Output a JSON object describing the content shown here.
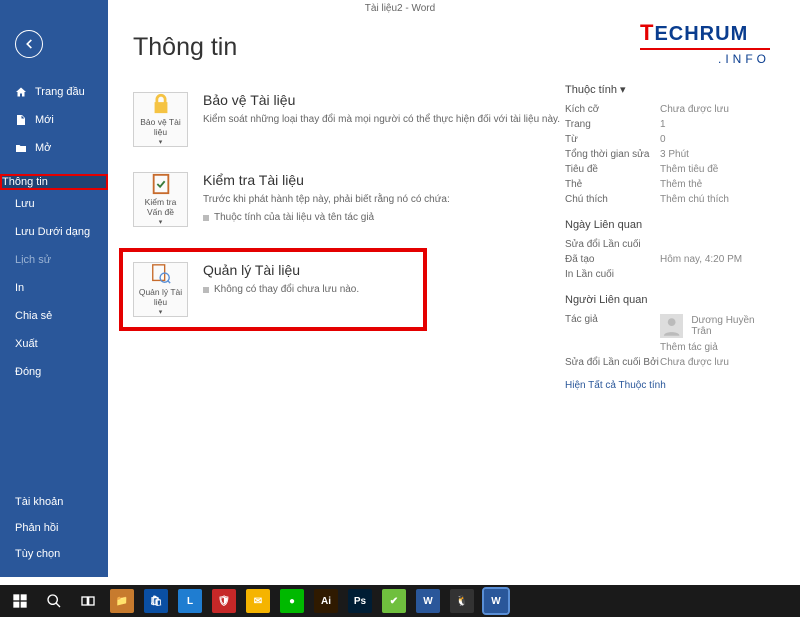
{
  "titlebar": "Tài liệu2  -  Word",
  "logo": {
    "t": "T",
    "rest": "ECHRUM",
    "suffix": ".INFO"
  },
  "sidebar": {
    "items": [
      {
        "label": "Trang đầu",
        "icon": "home"
      },
      {
        "label": "Mới",
        "icon": "new"
      },
      {
        "label": "Mở",
        "icon": "open"
      },
      {
        "label": "Thông tin",
        "active": true
      },
      {
        "label": "Lưu"
      },
      {
        "label": "Lưu Dưới dạng"
      },
      {
        "label": "Lịch sử",
        "dim": true
      },
      {
        "label": "In"
      },
      {
        "label": "Chia sẻ"
      },
      {
        "label": "Xuất"
      },
      {
        "label": "Đóng"
      }
    ],
    "bottom": [
      {
        "label": "Tài khoản"
      },
      {
        "label": "Phản hồi"
      },
      {
        "label": "Tùy chọn"
      }
    ]
  },
  "page_title": "Thông tin",
  "sections": {
    "protect": {
      "btn": "Bảo vệ Tài liệu",
      "title": "Bảo vệ Tài liệu",
      "desc": "Kiểm soát những loại thay đổi mà mọi người có thể thực hiện đối với tài liệu này."
    },
    "inspect": {
      "btn": "Kiểm tra Vấn đề",
      "title": "Kiểm tra Tài liệu",
      "desc": "Trước khi phát hành tệp này, phải biết rằng nó có chứa:",
      "item1": "Thuộc tính của tài liệu và tên tác giả"
    },
    "manage": {
      "btn": "Quản lý Tài liệu",
      "title": "Quản lý Tài liệu",
      "item1": "Không có thay đổi chưa lưu nào."
    }
  },
  "props": {
    "heading1": "Thuộc tính",
    "rows1": [
      {
        "k": "Kích cỡ",
        "v": "Chưa được lưu"
      },
      {
        "k": "Trang",
        "v": "1"
      },
      {
        "k": "Từ",
        "v": "0"
      },
      {
        "k": "Tổng thời gian sửa",
        "v": "3 Phút"
      },
      {
        "k": "Tiêu đề",
        "v": "Thêm tiêu đề"
      },
      {
        "k": "Thẻ",
        "v": "Thêm thẻ"
      },
      {
        "k": "Chú thích",
        "v": "Thêm chú thích"
      }
    ],
    "heading2": "Ngày Liên quan",
    "rows2": [
      {
        "k": "Sửa đổi Lần cuối",
        "v": ""
      },
      {
        "k": "Đã tạo",
        "v": "Hôm nay, 4:20 PM"
      },
      {
        "k": "In Lần cuối",
        "v": ""
      }
    ],
    "heading3": "Người Liên quan",
    "author_label": "Tác giả",
    "author_name": "Dương Huyền Trân",
    "add_author": "Thêm tác giả",
    "lastmod_label": "Sửa đổi Lần cuối Bởi",
    "lastmod_value": "Chưa được lưu",
    "show_all": "Hiện Tất cả Thuộc tính"
  }
}
